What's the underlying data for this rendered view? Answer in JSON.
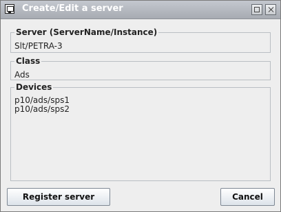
{
  "window": {
    "title": "Create/Edit a server",
    "icon": "app-window-icon",
    "controls": [
      "maximize-icon",
      "close-icon"
    ]
  },
  "server_group": {
    "label": "Server  (ServerName/Instance)",
    "value": "Slt/PETRA-3"
  },
  "class_group": {
    "label": "Class",
    "value": "Ads"
  },
  "devices_group": {
    "label": "Devices",
    "items": [
      "p10/ads/sps1",
      "p10/ads/sps2"
    ]
  },
  "buttons": {
    "register": "Register server",
    "cancel": "Cancel"
  }
}
